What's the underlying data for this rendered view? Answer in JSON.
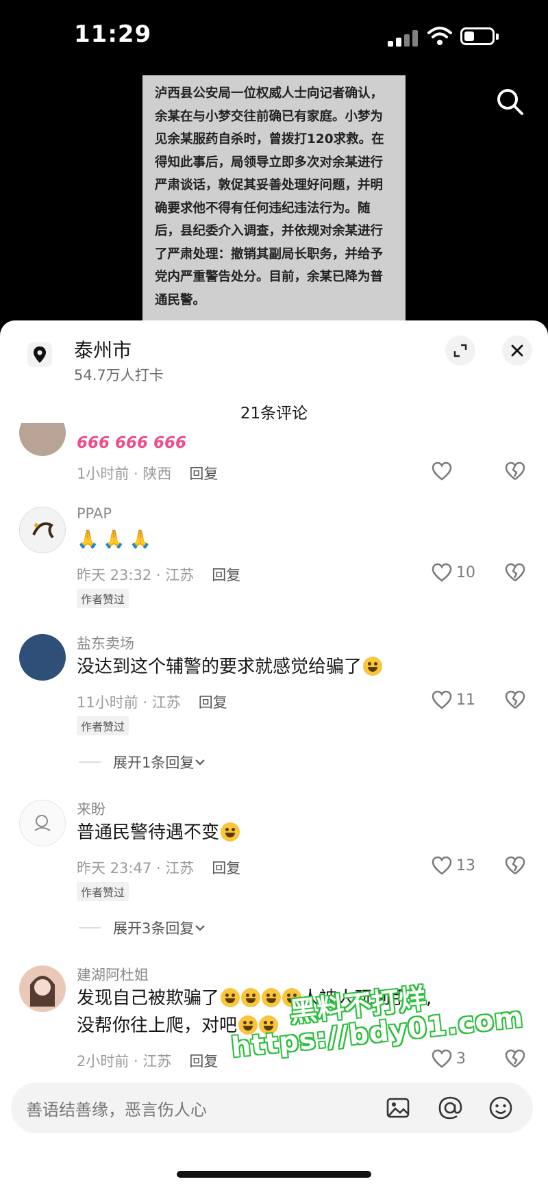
{
  "status_bar": {
    "time": "11:29"
  },
  "news_text": "泸西县公安局一位权威人士向记者确认，余某在与小梦交往前确已有家庭。小梦为见余某服药自杀时，曾拨打120求救。在得知此事后，局领导立即多次对余某进行严肃谈话，敦促其妥善处理好问题，并明确要求他不得有任何违纪违法行为。随后，县纪委介入调查，并依规对余某进行了严肃处理：撤销其副局长职务，并给予党内严重警告处分。目前，余某已降为普通民警。",
  "location": {
    "title": "泰州市",
    "subtitle": "54.7万人打卡"
  },
  "comment_count": "21条评论",
  "comments": [
    {
      "username": "",
      "content_prefix": "666 666 666",
      "time": "1小时前 · 陕西",
      "reply": "回复",
      "likes": "",
      "badge": ""
    },
    {
      "username": "PPAP",
      "content_prefix": "",
      "time": "昨天 23:32 · 江苏",
      "reply": "回复",
      "likes": "10",
      "badge": "作者赞过"
    },
    {
      "username": "盐东卖场",
      "content": "没达到这个辅警的要求就感觉给骗了",
      "time": "11小时前 · 江苏",
      "reply": "回复",
      "likes": "11",
      "badge": "作者赞过",
      "expand": "展开1条回复"
    },
    {
      "username": "来盼",
      "content": "普通民警待遇不变",
      "time": "昨天 23:47 · 江苏",
      "reply": "回复",
      "likes": "13",
      "badge": "作者赞过",
      "expand": "展开3条回复"
    },
    {
      "username": "建湖阿杜姐",
      "content_line1": "发现自己被欺骗了",
      "content_line1_tail": "人被人玩到手了,",
      "content_line2": "没帮你往上爬，对吧",
      "time": "2小时前 · 江苏",
      "reply": "回复",
      "likes": "3"
    }
  ],
  "input": {
    "placeholder": "善语结善缘，恶言伤人心"
  },
  "watermark": {
    "line1": "黑料不打烊",
    "line2": "https://bdy01.com"
  },
  "colors": {
    "like_gray": "#7a7a7a",
    "watermark_green": "#2cbf3d",
    "emoji_yellow": "#f8c53c"
  }
}
